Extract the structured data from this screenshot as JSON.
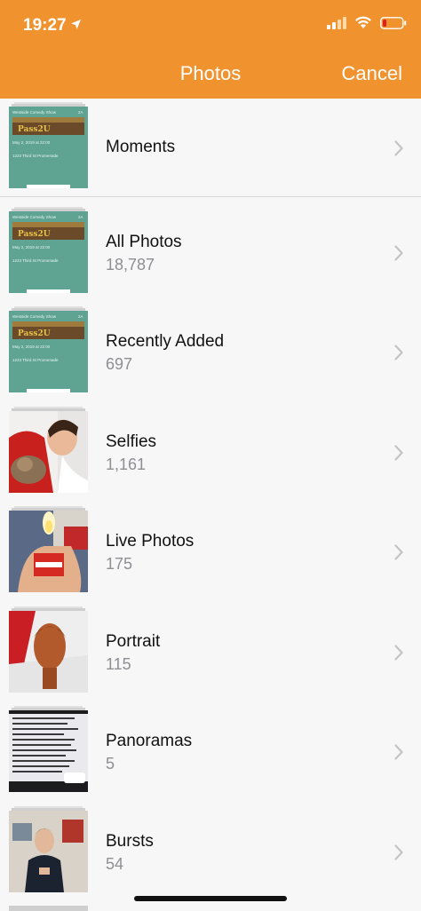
{
  "status": {
    "time": "19:27"
  },
  "nav": {
    "title": "Photos",
    "cancel": "Cancel"
  },
  "albums": [
    {
      "label": "Moments",
      "count": ""
    },
    {
      "label": "All Photos",
      "count": "18,787"
    },
    {
      "label": "Recently Added",
      "count": "697"
    },
    {
      "label": "Selfies",
      "count": "1,161"
    },
    {
      "label": "Live Photos",
      "count": "175"
    },
    {
      "label": "Portrait",
      "count": "115"
    },
    {
      "label": "Panoramas",
      "count": "5"
    },
    {
      "label": "Bursts",
      "count": "54"
    }
  ],
  "ticket": {
    "title": "Westside Comedy Show",
    "badge": "2A",
    "logo": "Pass2U",
    "date": "May 2, 2019 at 22:00",
    "address": "1223 Third St Promenade"
  },
  "theme": {
    "header": "#f0932f",
    "ticket_green": "#5fa393"
  }
}
